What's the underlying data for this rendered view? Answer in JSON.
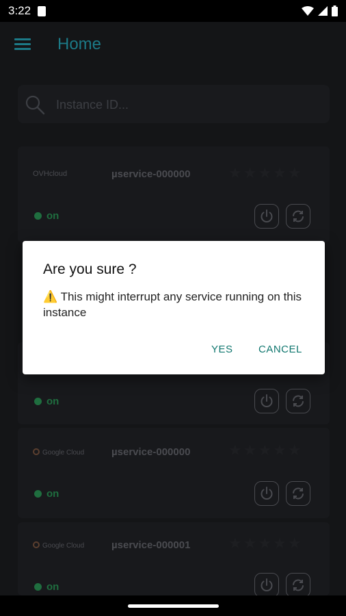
{
  "status_bar": {
    "time": "3:22",
    "icons": [
      "sd-card-icon",
      "wifi-icon",
      "signal-icon",
      "battery-icon"
    ]
  },
  "app_bar": {
    "title": "Home",
    "menu_icon": "menu-icon"
  },
  "search": {
    "placeholder": "Instance ID...",
    "value": ""
  },
  "cards": [
    {
      "provider": "OVHcloud",
      "service": "µservice-000000",
      "status": "on"
    },
    {
      "status": "on"
    },
    {
      "provider": "Google Cloud",
      "service": "µservice-000000",
      "status": "on"
    },
    {
      "provider": "Google Cloud",
      "service": "µservice-000001",
      "status": "on"
    }
  ],
  "dialog": {
    "title": "Are you sure ?",
    "warning_icon": "⚠️",
    "message": "This might interrupt any service running on this instance",
    "yes_label": "YES",
    "cancel_label": "CANCEL"
  },
  "colors": {
    "accent": "#1c7a87",
    "status_on": "#1f6e3f",
    "dialog_button": "#0f766e",
    "background": "#141517"
  }
}
